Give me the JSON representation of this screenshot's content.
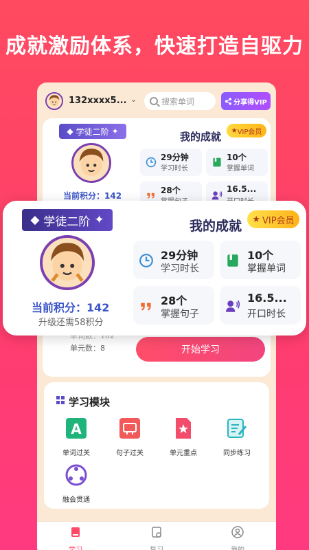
{
  "headline": "成就激励体系，快速打造自驱力",
  "topbar": {
    "account": "132xxxx5...",
    "search_placeholder": "搜索单词",
    "share_label": "分享得VIP"
  },
  "profile": {
    "level_badge": "学徒二阶",
    "points": "当前积分：142",
    "upgrade_hint": "升级还需58积分",
    "words_count": "单词数：102",
    "units_count": "单元数：8"
  },
  "achievements": {
    "title": "我的成就",
    "vip_label": "VIP会员",
    "stats": [
      {
        "value": "29分钟",
        "label": "学习时长",
        "icon": "clock-icon",
        "color": "#3b8fd6"
      },
      {
        "value": "10个",
        "label": "掌握单词",
        "icon": "book-icon",
        "color": "#27a85c"
      },
      {
        "value": "28个",
        "label": "掌握句子",
        "icon": "quote-icon",
        "color": "#f26b2e"
      },
      {
        "value": "16.5...",
        "label": "开口时长",
        "icon": "speak-icon",
        "color": "#6a3fbf"
      }
    ]
  },
  "start_button": "开始学习",
  "modules": {
    "title": "学习模块",
    "items": [
      {
        "label": "单词过关",
        "icon": "letter-a-icon",
        "color": "#1fb57a"
      },
      {
        "label": "句子过关",
        "icon": "sentence-icon",
        "color": "#f25a5a"
      },
      {
        "label": "单元重点",
        "icon": "star-doc-icon",
        "color": "#f24d6a"
      },
      {
        "label": "同步练习",
        "icon": "practice-icon",
        "color": "#2ab5c0"
      },
      {
        "label": "融会贯通",
        "icon": "circle-arrows-icon",
        "color": "#7b4fd1"
      }
    ]
  },
  "tabs": [
    {
      "label": "学习",
      "icon": "book-tab-icon",
      "active": true
    },
    {
      "label": "复习",
      "icon": "review-tab-icon",
      "active": false
    },
    {
      "label": "我的",
      "icon": "user-tab-icon",
      "active": false
    }
  ],
  "colors": {
    "background": "#ff4a6a",
    "accent_pink": "#ff4d6a",
    "badge_purple": "#5a4cc8",
    "points_blue": "#3b55c8",
    "vip_gold": "#ffc21a"
  }
}
